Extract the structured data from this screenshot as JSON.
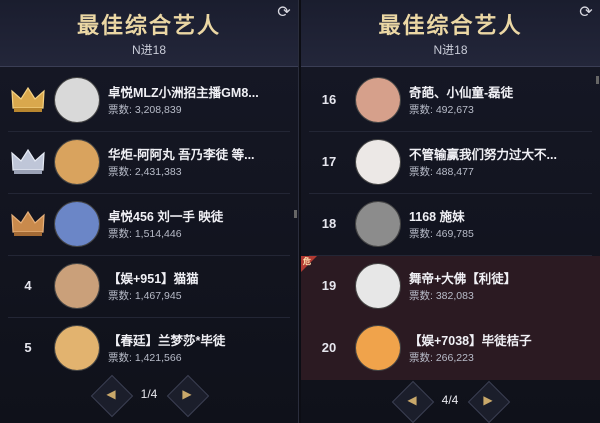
{
  "left": {
    "title": "最佳综合艺人",
    "subtitle": "N进18",
    "refresh_icon": "refresh-icon",
    "rows": [
      {
        "rank": "",
        "crown": "gold",
        "name": "卓悦MLZ小洲招主播GM8...",
        "votes": "票数: 3,208,839",
        "avatar_color": "#d9d9d9"
      },
      {
        "rank": "",
        "crown": "silver",
        "name": "华炬-阿阿丸 吾乃李徒 等...",
        "votes": "票数: 2,431,383",
        "avatar_color": "#d9a35e"
      },
      {
        "rank": "",
        "crown": "bronze",
        "name": "卓悦456 刘一手 映徒",
        "votes": "票数: 1,514,446",
        "avatar_color": "#6b86c7"
      },
      {
        "rank": "4",
        "crown": "",
        "name": "【娱+951】猫猫",
        "votes": "票数: 1,467,945",
        "avatar_color": "#caa07a"
      },
      {
        "rank": "5",
        "crown": "",
        "name": "【春廷】兰梦莎*毕徒",
        "votes": "票数: 1,421,566",
        "avatar_color": "#e2b36f"
      }
    ],
    "pager": {
      "text": "1/4"
    }
  },
  "right": {
    "title": "最佳综合艺人",
    "subtitle": "N进18",
    "refresh_icon": "refresh-icon",
    "rows": [
      {
        "rank": "16",
        "badge": "",
        "name": "奇葩、小仙童-磊徒",
        "votes": "票数: 492,673",
        "avatar_color": "#d6a08b"
      },
      {
        "rank": "17",
        "badge": "",
        "name": "不管输赢我们努力过大不...",
        "votes": "票数: 488,477",
        "avatar_color": "#ece8e6"
      },
      {
        "rank": "18",
        "badge": "",
        "name": "1168 施妹",
        "votes": "票数: 469,785",
        "avatar_color": "#8c8c8c"
      },
      {
        "rank": "19",
        "badge": "危",
        "name": "舞帝+大佛【利徒】",
        "votes": "票数: 382,083",
        "avatar_color": "#e7e7e7"
      },
      {
        "rank": "20",
        "badge": "",
        "name": "【娱+7038】毕徒桔子",
        "votes": "票数: 266,223",
        "avatar_color": "#f0a34b"
      }
    ],
    "pager": {
      "text": "4/4"
    }
  }
}
